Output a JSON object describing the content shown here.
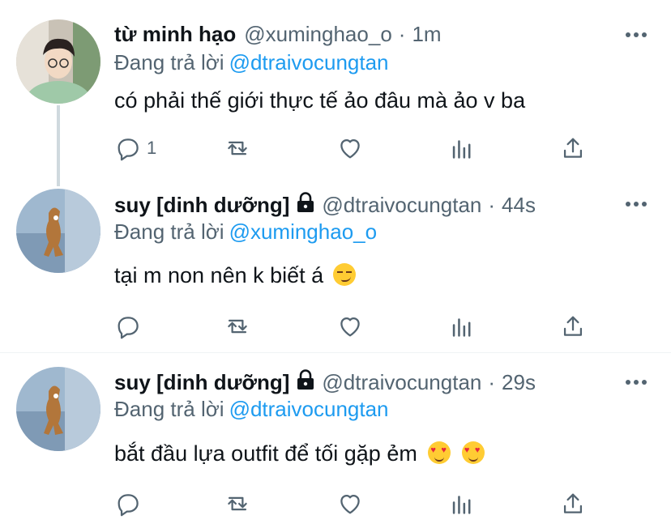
{
  "tweets": [
    {
      "name": "từ minh hạo",
      "handle": "@xuminghao_o",
      "dot": "·",
      "time": "1m",
      "reply_prefix": "Đang trả lời",
      "reply_to": "@dtraivocungtan",
      "text": "có phải thế giới thực tế ảo đâu mà ảo v ba",
      "reply_count": "1",
      "locked": false
    },
    {
      "name": "suy [dinh dưỡng]",
      "handle": "@dtraivocungtan",
      "dot": "·",
      "time": "44s",
      "reply_prefix": "Đang trả lời",
      "reply_to": "@xuminghao_o",
      "text": "tại m non nên k biết á",
      "emoji": [
        "smirking-face"
      ],
      "reply_count": "",
      "locked": true
    },
    {
      "name": "suy [dinh dưỡng]",
      "handle": "@dtraivocungtan",
      "dot": "·",
      "time": "29s",
      "reply_prefix": "Đang trả lời",
      "reply_to": "@dtraivocungtan",
      "text": "bắt đầu lựa outfit để tối gặp ẻm",
      "emoji": [
        "heart-eyes",
        "heart-eyes"
      ],
      "reply_count": "",
      "locked": true
    }
  ],
  "colors": {
    "text": "#0f1419",
    "secondary": "#536471",
    "mention": "#1d9bf0",
    "thread_line": "#cfd9de",
    "divider": "#eff3f4"
  },
  "icons": [
    "reply-icon",
    "retweet-icon",
    "like-icon",
    "analytics-icon",
    "share-icon",
    "lock-icon",
    "more-icon"
  ]
}
